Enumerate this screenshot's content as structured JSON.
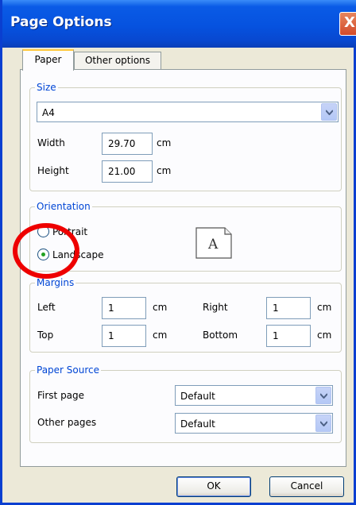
{
  "window": {
    "title": "Page Options",
    "close": "X"
  },
  "tabs": [
    {
      "label": "Paper"
    },
    {
      "label": "Other options"
    }
  ],
  "size": {
    "legend": "Size",
    "paper_select": "A4",
    "width_label": "Width",
    "width_value": "29.70",
    "width_unit": "cm",
    "height_label": "Height",
    "height_value": "21.00",
    "height_unit": "cm"
  },
  "orientation": {
    "legend": "Orientation",
    "portrait_label": "Portrait",
    "landscape_label": "Landscape",
    "selected": "landscape",
    "preview_glyph": "A"
  },
  "margins": {
    "legend": "Margins",
    "left_label": "Left",
    "left_value": "1",
    "left_unit": "cm",
    "right_label": "Right",
    "right_value": "1",
    "right_unit": "cm",
    "top_label": "Top",
    "top_value": "1",
    "top_unit": "cm",
    "bottom_label": "Bottom",
    "bottom_value": "1",
    "bottom_unit": "cm"
  },
  "paper_source": {
    "legend": "Paper Source",
    "first_label": "First page",
    "first_value": "Default",
    "other_label": "Other pages",
    "other_value": "Default"
  },
  "buttons": {
    "ok": "OK",
    "cancel": "Cancel"
  },
  "colors": {
    "titlebar": "#0652df",
    "legend": "#0046d5",
    "highlight": "#ee0000",
    "radio_selected": "#21a121"
  }
}
